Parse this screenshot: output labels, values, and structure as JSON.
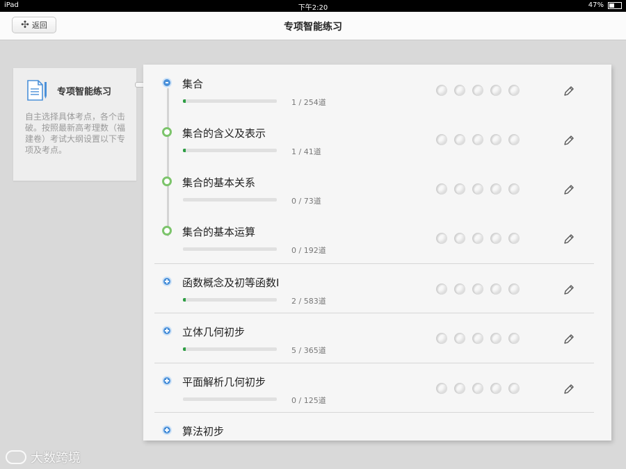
{
  "status_bar": {
    "device": "iPad",
    "time": "下午2:20",
    "battery": "47%"
  },
  "nav": {
    "title": "专项智能练习",
    "back_label": "返回"
  },
  "side_card": {
    "title": "专项智能练习",
    "description": "自主选择具体考点，各个击破。按照最新高考理数（福建卷）考试大纲设置以下专项及考点。"
  },
  "topics": [
    {
      "title": "集合",
      "count": "1 / 254道",
      "progress": 0.004,
      "marker": "minus"
    },
    {
      "title": "集合的含义及表示",
      "count": "1 / 41道",
      "progress": 0.024,
      "marker": "green"
    },
    {
      "title": "集合的基本关系",
      "count": "0 / 73道",
      "progress": 0,
      "marker": "green"
    },
    {
      "title": "集合的基本运算",
      "count": "0 / 192道",
      "progress": 0,
      "marker": "green"
    },
    {
      "title": "函数概念及初等函数I",
      "count": "2 / 583道",
      "progress": 0.003,
      "marker": "plus"
    },
    {
      "title": "立体几何初步",
      "count": "5 / 365道",
      "progress": 0.014,
      "marker": "plus"
    },
    {
      "title": "平面解析几何初步",
      "count": "0 / 125道",
      "progress": 0,
      "marker": "plus"
    },
    {
      "title": "算法初步",
      "count": "",
      "progress": 0,
      "marker": "plus"
    }
  ],
  "stars_per_topic": 5,
  "icons": {
    "back": "back-arrow-icon",
    "edit": "pencil-icon",
    "rating": "moon-icon",
    "doc": "document-icon"
  },
  "watermark": {
    "text": "大数跨境"
  },
  "colors": {
    "accent_blue": "#4a90d9",
    "progress_green": "#2e9e44",
    "marker_green": "#7cc46b"
  }
}
